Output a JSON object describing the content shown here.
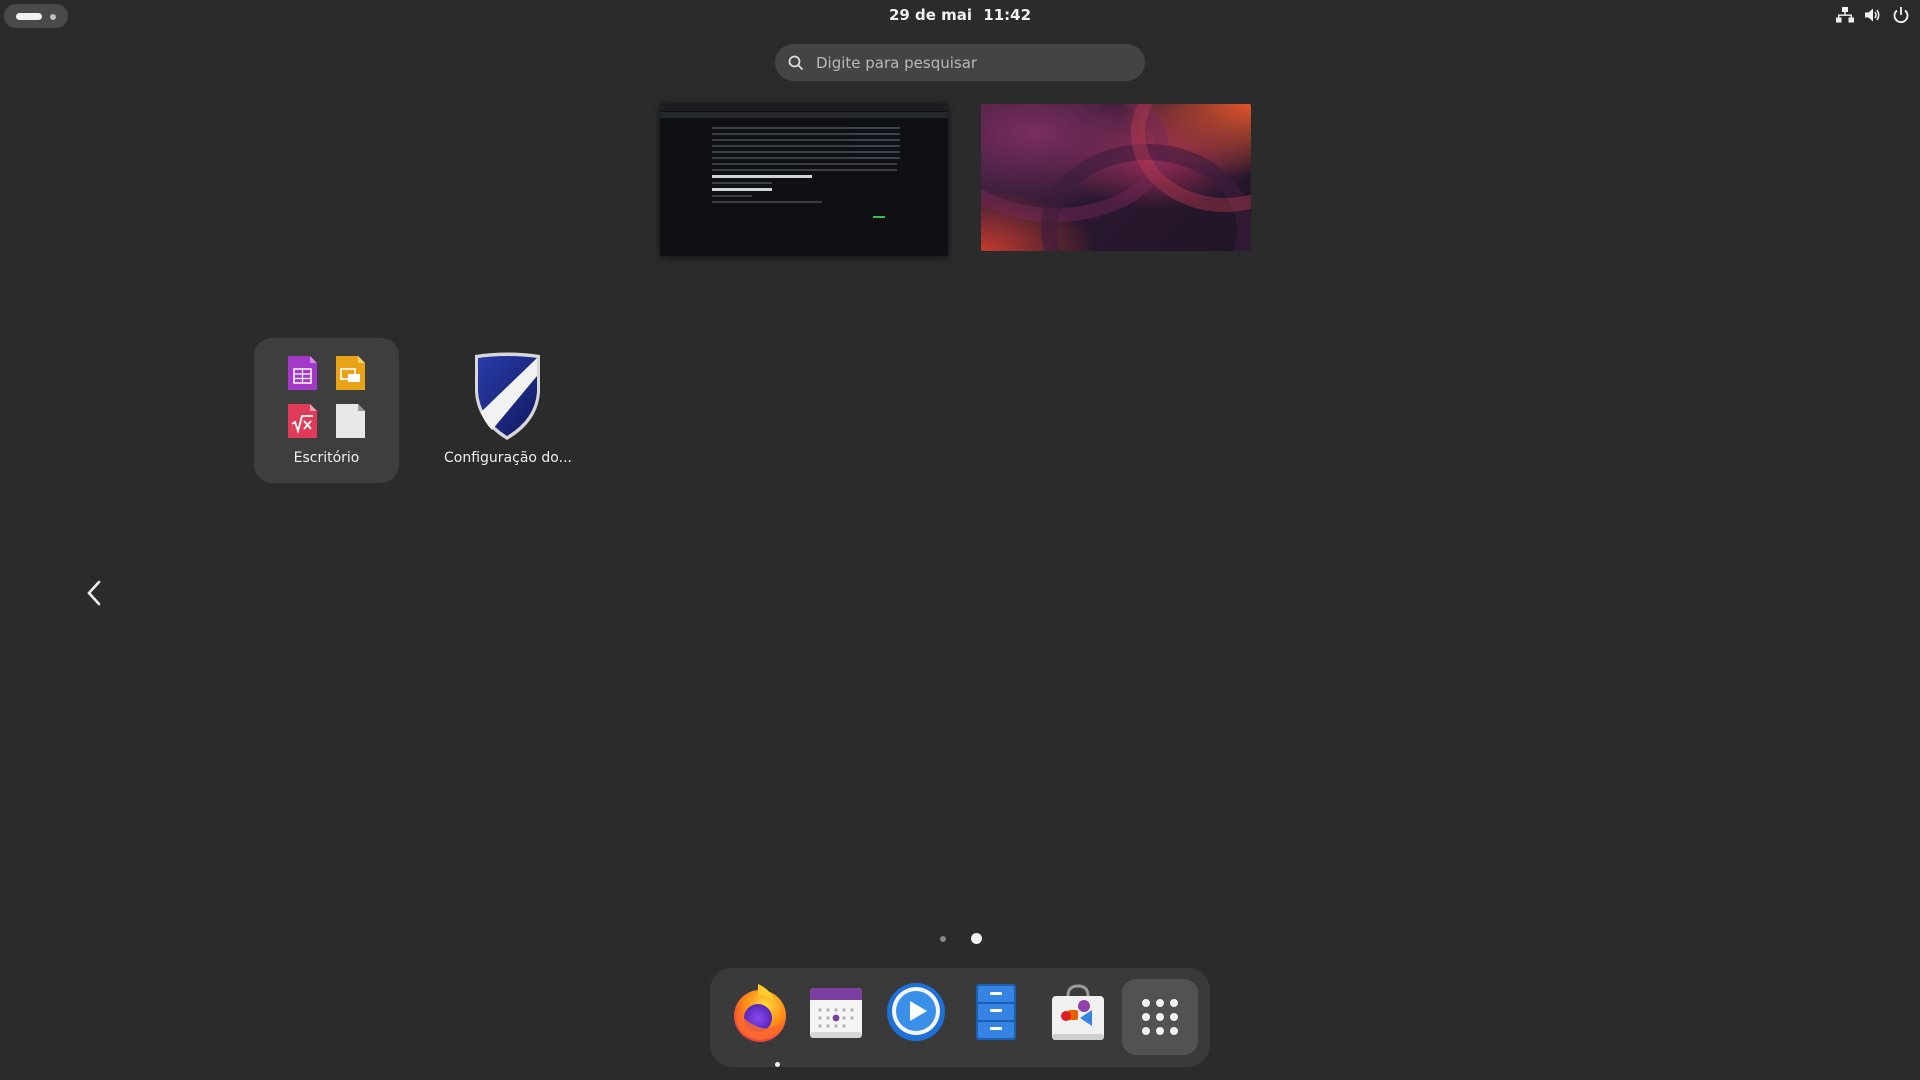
{
  "topbar": {
    "date": "29 de mai",
    "time": "11:42",
    "tray_icons": [
      "network-icon",
      "volume-icon",
      "power-icon"
    ]
  },
  "search": {
    "placeholder": "Digite para pesquisar"
  },
  "workspaces": [
    {
      "name": "workspace-1",
      "content": "browser-window"
    },
    {
      "name": "workspace-2",
      "content": "wallpaper"
    }
  ],
  "app_grid": {
    "items": [
      {
        "label": "Escritório",
        "type": "folder",
        "icons": [
          "libreoffice-calc-icon",
          "libreoffice-impress-icon",
          "libreoffice-math-icon",
          "libreoffice-draw-icon"
        ]
      },
      {
        "label": "Configuração do...",
        "icon": "shield-icon"
      }
    ],
    "pages": {
      "total": 2,
      "current": 2
    }
  },
  "dock": {
    "apps": [
      {
        "name": "firefox",
        "icon": "firefox-icon",
        "running": true
      },
      {
        "name": "calendar",
        "icon": "calendar-icon",
        "running": false
      },
      {
        "name": "videos",
        "icon": "video-player-icon",
        "running": false
      },
      {
        "name": "files",
        "icon": "file-cabinet-icon",
        "running": false
      },
      {
        "name": "software",
        "icon": "software-store-icon",
        "running": false
      }
    ],
    "show_apps_icon": "app-grid-icon"
  },
  "colors": {
    "background": "#2b2b2b",
    "dock": "#3a3a3a",
    "search": "#444444"
  }
}
